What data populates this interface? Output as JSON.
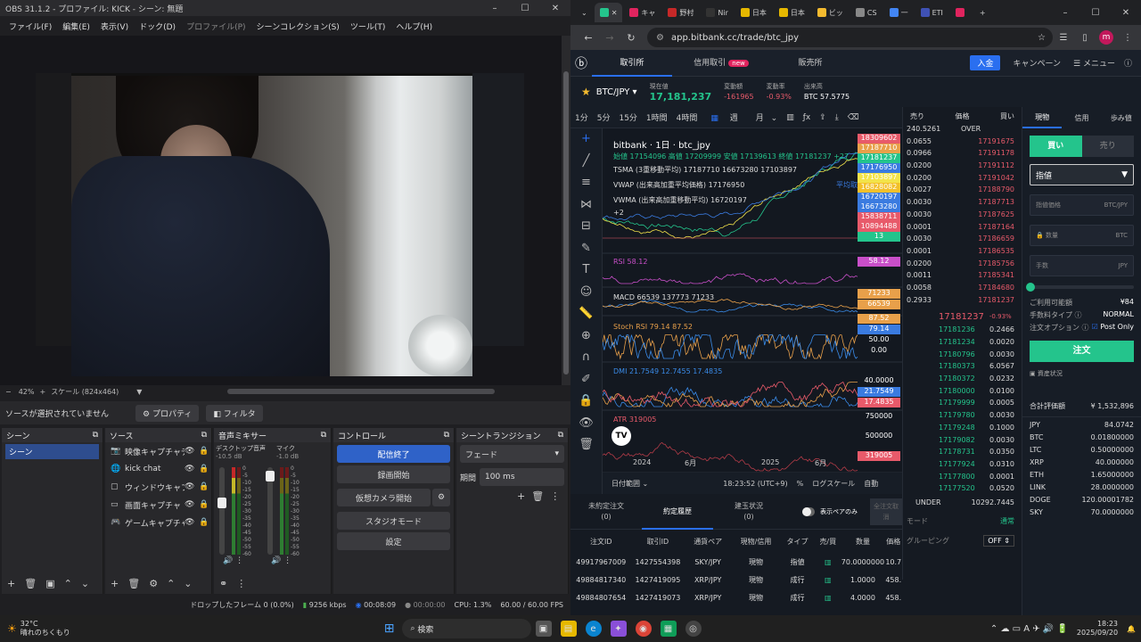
{
  "obs": {
    "title": "OBS 31.1.2 - プロファイル: KICK - シーン: 無題",
    "menu": [
      "ファイル(F)",
      "編集(E)",
      "表示(V)",
      "ドック(D)",
      "プロファイル(P)",
      "シーンコレクション(S)",
      "ツール(T)",
      "ヘルプ(H)"
    ],
    "zoom": "42%",
    "scale": "スケール (824x464)",
    "no_source": "ソースが選択されていません",
    "properties": "プロパティ",
    "filters": "フィルタ",
    "docks": {
      "scenes": {
        "title": "シーン",
        "items": [
          "シーン"
        ]
      },
      "sources": {
        "title": "ソース",
        "items": [
          {
            "icon": "camera-icon",
            "name": "映像キャプチャデ"
          },
          {
            "icon": "globe-icon",
            "name": "kick chat"
          },
          {
            "icon": "window-icon",
            "name": "ウィンドウキャプチ"
          },
          {
            "icon": "monitor-icon",
            "name": "画面キャプチャ"
          },
          {
            "icon": "gamepad-icon",
            "name": "ゲームキャプチャ"
          }
        ]
      },
      "mixer": {
        "title": "音声ミキサー",
        "channels": [
          {
            "name": "デスクトップ音声",
            "db": "-10.5 dB"
          },
          {
            "name": "マイク",
            "db": "-1.0 dB"
          }
        ],
        "ticks": [
          "0",
          "-5",
          "-10",
          "-15",
          "-20",
          "-25",
          "-30",
          "-35",
          "-40",
          "-45",
          "-50",
          "-55",
          "-60"
        ]
      },
      "controls": {
        "title": "コントロール",
        "buttons": [
          "配信終了",
          "録画開始",
          "仮想カメラ開始",
          "スタジオモード",
          "設定"
        ]
      },
      "transitions": {
        "title": "シーントランジション",
        "type": "フェード",
        "duration_label": "期間",
        "duration": "100 ms"
      }
    },
    "status": {
      "dropped": "ドロップしたフレーム 0 (0.0%)",
      "bitrate": "9256 kbps",
      "live": "00:08:09",
      "rec": "00:00:00",
      "cpu": "CPU: 1.3%",
      "fps": "60.00 / 60.00 FPS"
    }
  },
  "browser": {
    "tabs": [
      {
        "label": "",
        "color": "#24c48c"
      },
      {
        "label": "キャ",
        "color": "#e0245e"
      },
      {
        "label": "野村",
        "color": "#c62828"
      },
      {
        "label": "Nir",
        "color": "#333333"
      },
      {
        "label": "日本",
        "color": "#e6b800"
      },
      {
        "label": "日本",
        "color": "#e6b800"
      },
      {
        "label": "ビッ",
        "color": "#f3ba2f"
      },
      {
        "label": "CS",
        "color": "#888888"
      },
      {
        "label": "一",
        "color": "#4285f4"
      },
      {
        "label": "ETI",
        "color": "#3f51b5"
      },
      {
        "label": "",
        "color": "#e0245e"
      }
    ],
    "url": "app.bitbank.cc/trade/btc_jpy",
    "profile": "m"
  },
  "site": {
    "nav": [
      "取引所",
      "信用取引",
      "販売所"
    ],
    "new_badge": "new",
    "deposit": "入金",
    "campaign": "キャンペーン",
    "menu": "メニュー",
    "pair": "BTC/JPY",
    "ticker": [
      {
        "label": "現在値",
        "value": "17,181,237",
        "color": "#24c48c"
      },
      {
        "label": "変動額",
        "value": "-161965",
        "color": "#e85a6a"
      },
      {
        "label": "変動率",
        "value": "-0.93%",
        "color": "#e85a6a"
      },
      {
        "label": "出来高",
        "value": "BTC 57.5775",
        "color": "#ffffff"
      }
    ],
    "intervals": [
      "1分",
      "5分",
      "15分",
      "1時間",
      "4時間",
      "週",
      "月"
    ],
    "chart": {
      "title": "bitbank · 1日 · btc_jpy",
      "ohlc": "始値 17154096 高値 17209999 安値 17139613 終値 17181237 +27",
      "tsma": "TSMA (3重移動平均) 17187710 16673280 17103897",
      "vwap": "VWAP (出来高加重平均価格) 17176950",
      "vwma": "VWMA (出来高加重移動平均) 16720197",
      "more": "+2",
      "avg_label": "平均取",
      "rsi": "RSI 58.12",
      "macd": "MACD 66539 137773 71233",
      "stoch": "Stoch RSI 79.14 87.52",
      "dmi": "DMI 21.7549 12.7455 17.4835",
      "atr": "ATR 319005",
      "price_tags": [
        "18309602",
        "17187710",
        "17181237",
        "17176950",
        "17103897",
        "16828082",
        "16720197",
        "16673280",
        "15838711",
        "10894488",
        "13"
      ],
      "rsi_tag": "58.12",
      "macd_tags": [
        "71233",
        "66539"
      ],
      "stoch_tags": [
        "87.52",
        "79.14",
        "50.00",
        "0.00"
      ],
      "dmi_tags": [
        "40.0000",
        "21.7549",
        "17.4835"
      ],
      "atr_tags": [
        "750000",
        "500000",
        "319005"
      ],
      "x_labels": [
        "2024",
        "6月",
        "2025",
        "6月"
      ],
      "date_range": "日付範囲",
      "time": "18:23:52 (UTC+9)",
      "pct": "%",
      "log": "ログスケール",
      "auto": "自動"
    },
    "orderbook": {
      "headers": [
        "売り",
        "価格",
        "買い"
      ],
      "top_amt": "240.5261",
      "top_label": "OVER",
      "asks": [
        [
          "0.0655",
          "17191675"
        ],
        [
          "0.0966",
          "17191178"
        ],
        [
          "0.0200",
          "17191112"
        ],
        [
          "0.0200",
          "17191042"
        ],
        [
          "0.0027",
          "17188790"
        ],
        [
          "0.0030",
          "17187713"
        ],
        [
          "0.0030",
          "17187625"
        ],
        [
          "0.0001",
          "17187164"
        ],
        [
          "0.0030",
          "17186659"
        ],
        [
          "0.0001",
          "17186535"
        ],
        [
          "0.0200",
          "17185756"
        ],
        [
          "0.0011",
          "17185341"
        ],
        [
          "0.0058",
          "17184680"
        ],
        [
          "0.2933",
          "17181237"
        ]
      ],
      "mid": "17181237",
      "mid_pct": "-0.93%",
      "bids": [
        [
          "17181236",
          "0.2466"
        ],
        [
          "17181234",
          "0.0020"
        ],
        [
          "17180796",
          "0.0030"
        ],
        [
          "17180373",
          "6.0567"
        ],
        [
          "17180372",
          "0.0232"
        ],
        [
          "17180000",
          "0.0100"
        ],
        [
          "17179999",
          "0.0005"
        ],
        [
          "17179780",
          "0.0030"
        ],
        [
          "17179248",
          "0.1000"
        ],
        [
          "17179082",
          "0.0030"
        ],
        [
          "17178731",
          "0.0350"
        ],
        [
          "17177924",
          "0.0310"
        ],
        [
          "17177800",
          "0.0001"
        ],
        [
          "17177520",
          "0.0520"
        ]
      ],
      "under_label": "UNDER",
      "under_amt": "10292.7445",
      "mode": "モード",
      "normal": "通常",
      "grouping": "グルーピング",
      "grouping_val": "OFF"
    },
    "order": {
      "tabs": [
        "現物",
        "信用",
        "歩み値"
      ],
      "buy": "買い",
      "sell": "売り",
      "type": "指値",
      "price_ph": "指値価格",
      "price_unit": "BTC/JPY",
      "qty_ph": "数量",
      "qty_unit": "BTC",
      "fee_ph": "手数",
      "fee_unit": "JPY",
      "available_label": "ご利用可能額",
      "available": "¥84",
      "fee_type_label": "手数料タイプ",
      "fee_type": "NORMAL",
      "option_label": "注文オプション",
      "post_only": "Post Only",
      "submit": "注文",
      "asset_status": "資産状況",
      "total_label": "合計評価額",
      "total": "¥ 1,532,896",
      "assets": [
        [
          "JPY",
          "84.0742"
        ],
        [
          "BTC",
          "0.01800000"
        ],
        [
          "LTC",
          "0.50000000"
        ],
        [
          "XRP",
          "40.000000"
        ],
        [
          "ETH",
          "1.65000000"
        ],
        [
          "LINK",
          "28.0000000"
        ],
        [
          "DOGE",
          "120.00001782"
        ],
        [
          "SKY",
          "70.0000000"
        ]
      ]
    },
    "trades": {
      "tabs": [
        "未約定注文\n(0)",
        "約定履歴",
        "建玉状況\n(0)"
      ],
      "pair_only": "表示ペアのみ",
      "cancel_all": "全注文取消",
      "headers": [
        "注文ID",
        "取引ID",
        "通貨ペア",
        "現物/信用",
        "タイプ",
        "売/買",
        "数量",
        "価格"
      ],
      "rows": [
        [
          "49917967009",
          "1427554398",
          "SKY/JPY",
          "現物",
          "指値",
          "70.0000000",
          "10.7"
        ],
        [
          "49884817340",
          "1427419095",
          "XRP/JPY",
          "現物",
          "成行",
          "1.0000",
          "458."
        ],
        [
          "49884807654",
          "1427419073",
          "XRP/JPY",
          "現物",
          "成行",
          "4.0000",
          "458."
        ]
      ]
    }
  },
  "taskbar": {
    "weather_temp": "32°C",
    "weather_desc": "晴れのちくもり",
    "search": "検索",
    "time": "18:23",
    "date": "2025/09/20"
  }
}
